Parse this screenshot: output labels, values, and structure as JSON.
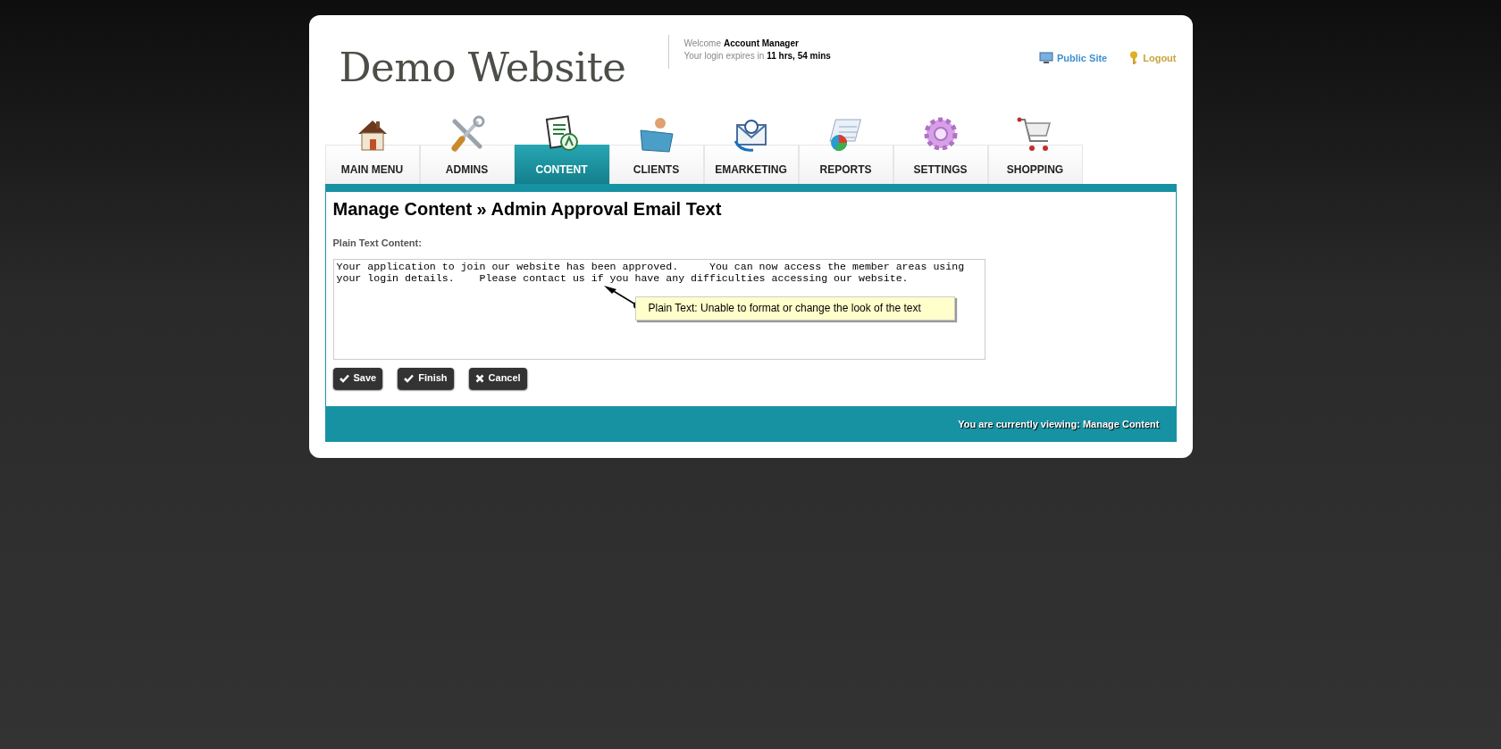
{
  "header": {
    "logo": "Demo Website",
    "welcome_label": "Welcome",
    "user": "Account Manager",
    "expires_label": "Your login expires in",
    "expires_value": "11 hrs, 54 mins",
    "links": [
      {
        "kind": "monitor",
        "label": "Public Site"
      },
      {
        "kind": "key",
        "label": "Logout"
      }
    ]
  },
  "tabs": [
    {
      "kind": "house",
      "label": "MAIN MENU",
      "selected": false
    },
    {
      "kind": "tools",
      "label": "ADMINS",
      "selected": false
    },
    {
      "kind": "document",
      "label": "CONTENT",
      "selected": true
    },
    {
      "kind": "person",
      "label": "CLIENTS",
      "selected": false
    },
    {
      "kind": "envelope",
      "label": "EMARKETING",
      "selected": false
    },
    {
      "kind": "chart",
      "label": "REPORTS",
      "selected": false
    },
    {
      "kind": "gear",
      "label": "SETTINGS",
      "selected": false
    },
    {
      "kind": "cart",
      "label": "SHOPPING",
      "selected": false
    }
  ],
  "page": {
    "title": "Manage Content » Admin Approval Email Text",
    "field_label": "Plain Text Content:",
    "content": "Your application to join our website has been approved.     You can now access the member areas using your login details.    Please contact us if you have any difficulties accessing our website.",
    "tooltip": "Plain Text: Unable to format or change the look of the text",
    "buttons": [
      {
        "kind": "check",
        "label": "Save"
      },
      {
        "kind": "check",
        "label": "Finish"
      },
      {
        "kind": "cross",
        "label": "Cancel"
      }
    ]
  },
  "footer": "You are currently viewing: Manage Content"
}
